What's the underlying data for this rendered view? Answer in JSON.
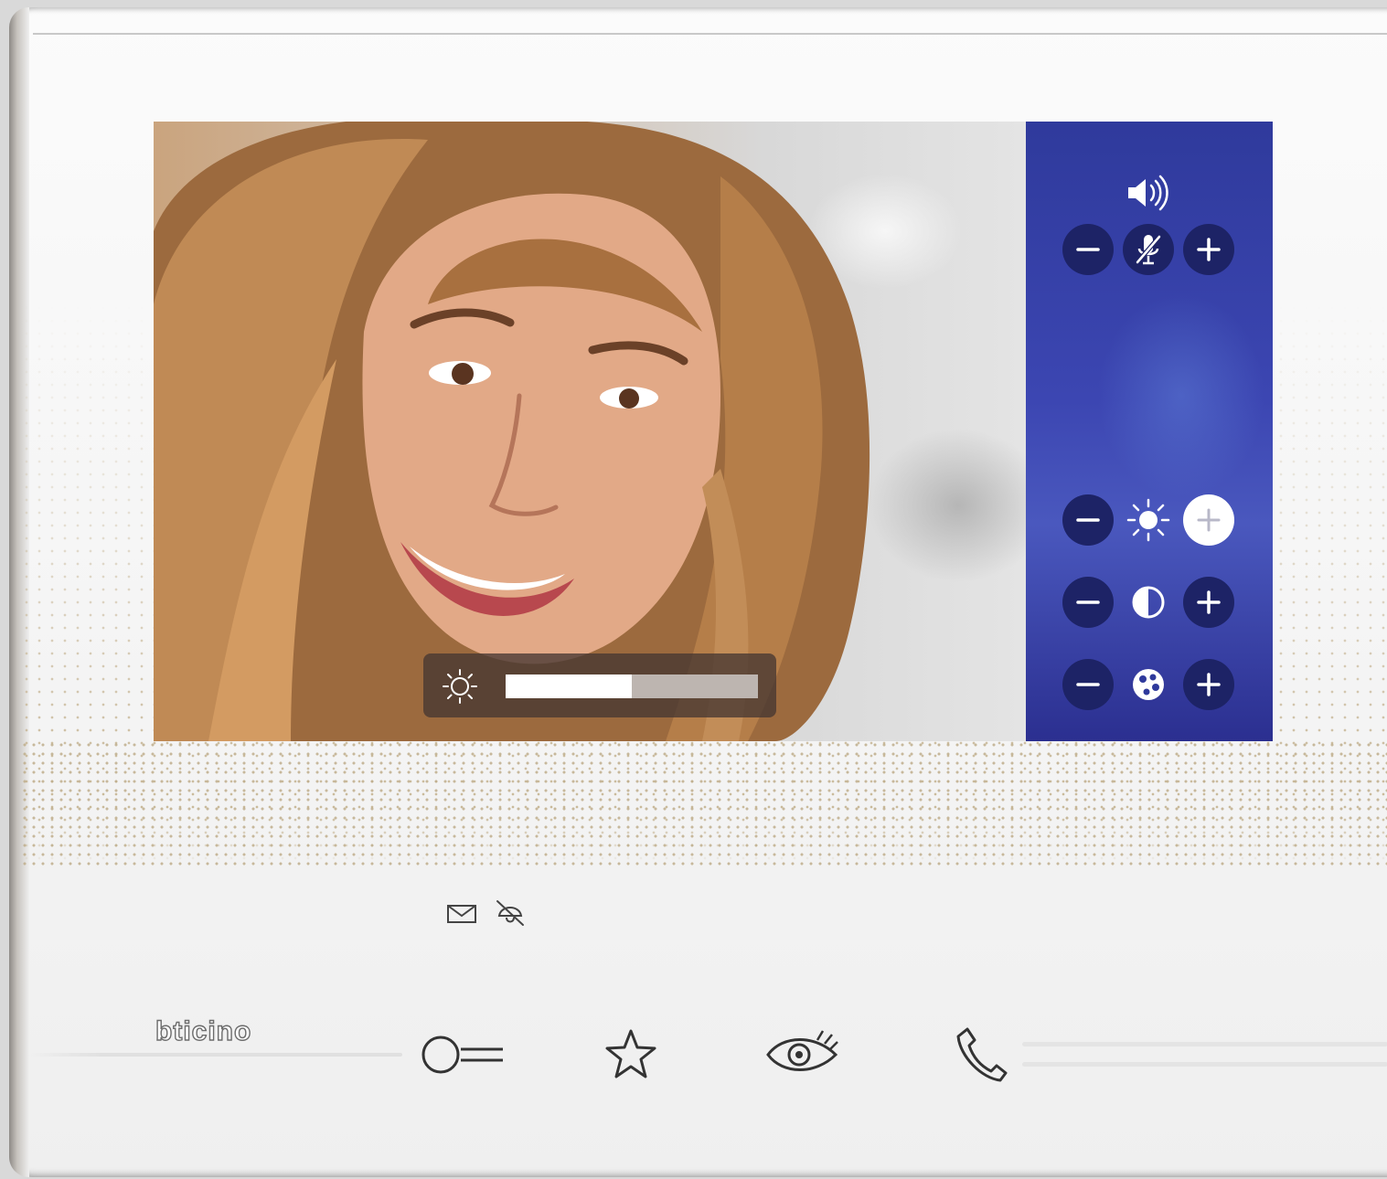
{
  "device": {
    "brand": "bticino",
    "accent_color": "#3a44ad",
    "panel_button_color": "#1d2366"
  },
  "video": {
    "brightness_overlay": {
      "icon": "sun-icon",
      "level": 0.5
    }
  },
  "controls": {
    "volume": {
      "icon": "speaker-icon",
      "minus": "−",
      "plus": "+",
      "mute_icon": "mic-muted-icon"
    },
    "brightness": {
      "icon": "sun-icon",
      "minus": "−",
      "plus": "+",
      "active": "plus"
    },
    "contrast": {
      "icon": "contrast-icon",
      "minus": "−",
      "plus": "+"
    },
    "color": {
      "icon": "color-palette-icon",
      "minus": "−",
      "plus": "+"
    }
  },
  "status_icons": [
    "envelope-icon",
    "bell-off-icon"
  ],
  "bottom_buttons": [
    "door-key-icon",
    "star-icon",
    "eye-icon",
    "phone-icon"
  ]
}
